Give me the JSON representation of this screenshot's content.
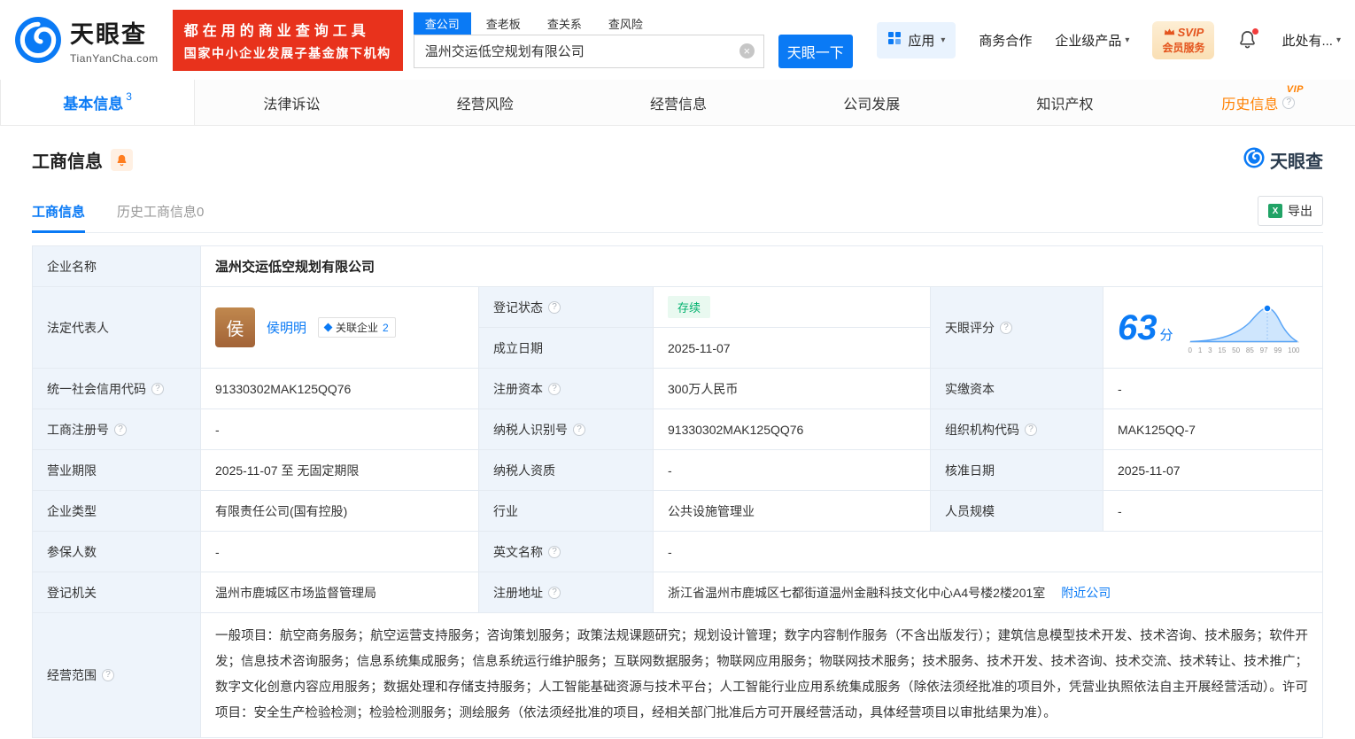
{
  "icons": {
    "help": "?",
    "caret": "▾",
    "clear": "×",
    "excel": "X"
  },
  "header": {
    "logo": {
      "title": "天眼查",
      "subtitle": "TianYanCha.com"
    },
    "slogan": {
      "line1": "都在用的商业查询工具",
      "line2": "国家中小企业发展子基金旗下机构"
    },
    "search": {
      "tabs": [
        "查公司",
        "查老板",
        "查关系",
        "查风险"
      ],
      "value": "温州交运低空规划有限公司",
      "button": "天眼一下"
    },
    "menu": {
      "apps": "应用",
      "cooperation": "商务合作",
      "enterprise": "企业级产品",
      "svip_title": "SVIP",
      "svip_subtitle": "会员服务",
      "more": "此处有..."
    }
  },
  "nav": {
    "tabs": [
      {
        "label": "基本信息",
        "badge": "3"
      },
      {
        "label": "法律诉讼"
      },
      {
        "label": "经营风险"
      },
      {
        "label": "经营信息"
      },
      {
        "label": "公司发展"
      },
      {
        "label": "知识产权"
      },
      {
        "label": "历史信息"
      }
    ],
    "vip_flag": "VIP"
  },
  "section": {
    "title": "工商信息",
    "brand": "天眼查",
    "tab_current": "工商信息",
    "tab_history": "历史工商信息",
    "tab_history_count": "0",
    "export": "导出"
  },
  "fields": {
    "company_name": {
      "label": "企业名称",
      "value": "温州交运低空规划有限公司"
    },
    "legal_rep": {
      "label": "法定代表人",
      "avatar": "侯",
      "name": "侯明明",
      "related_label": "关联企业",
      "related_count": "2"
    },
    "reg_status": {
      "label": "登记状态",
      "value": "存续"
    },
    "establish_date": {
      "label": "成立日期",
      "value": "2025-11-07"
    },
    "score": {
      "label": "天眼评分",
      "value": "63",
      "unit": "分",
      "axis": [
        "0",
        "1",
        "3",
        "15",
        "50",
        "85",
        "97",
        "99",
        "100"
      ]
    },
    "credit_code": {
      "label": "统一社会信用代码",
      "value": "91330302MAK125QQ76"
    },
    "reg_capital": {
      "label": "注册资本",
      "value": "300万人民币"
    },
    "paid_capital": {
      "label": "实缴资本",
      "value": "-"
    },
    "reg_number": {
      "label": "工商注册号",
      "value": "-"
    },
    "taxpayer_id": {
      "label": "纳税人识别号",
      "value": "91330302MAK125QQ76"
    },
    "org_code": {
      "label": "组织机构代码",
      "value": "MAK125QQ-7"
    },
    "business_term": {
      "label": "营业期限",
      "value": "2025-11-07 至 无固定期限"
    },
    "taxpayer_quality": {
      "label": "纳税人资质",
      "value": "-"
    },
    "approval_date": {
      "label": "核准日期",
      "value": "2025-11-07"
    },
    "company_type": {
      "label": "企业类型",
      "value": "有限责任公司(国有控股)"
    },
    "industry": {
      "label": "行业",
      "value": "公共设施管理业"
    },
    "staff_size": {
      "label": "人员规模",
      "value": "-"
    },
    "insured_count": {
      "label": "参保人数",
      "value": "-"
    },
    "english_name": {
      "label": "英文名称",
      "value": "-"
    },
    "reg_authority": {
      "label": "登记机关",
      "value": "温州市鹿城区市场监督管理局"
    },
    "reg_address": {
      "label": "注册地址",
      "value": "浙江省温州市鹿城区七都街道温州金融科技文化中心A4号楼2楼201室",
      "nearby": "附近公司"
    },
    "business_scope": {
      "label": "经营范围",
      "value": "一般项目：航空商务服务；航空运营支持服务；咨询策划服务；政策法规课题研究；规划设计管理；数字内容制作服务（不含出版发行）；建筑信息模型技术开发、技术咨询、技术服务；软件开发；信息技术咨询服务；信息系统集成服务；信息系统运行维护服务；互联网数据服务；物联网应用服务；物联网技术服务；技术服务、技术开发、技术咨询、技术交流、技术转让、技术推广；数字文化创意内容应用服务；数据处理和存储支持服务；人工智能基础资源与技术平台；人工智能行业应用系统集成服务（除依法须经批准的项目外，凭营业执照依法自主开展经营活动）。许可项目：安全生产检验检测；检验检测服务；测绘服务（依法须经批准的项目，经相关部门批准后方可开展经营活动，具体经营项目以审批结果为准）。"
    }
  }
}
